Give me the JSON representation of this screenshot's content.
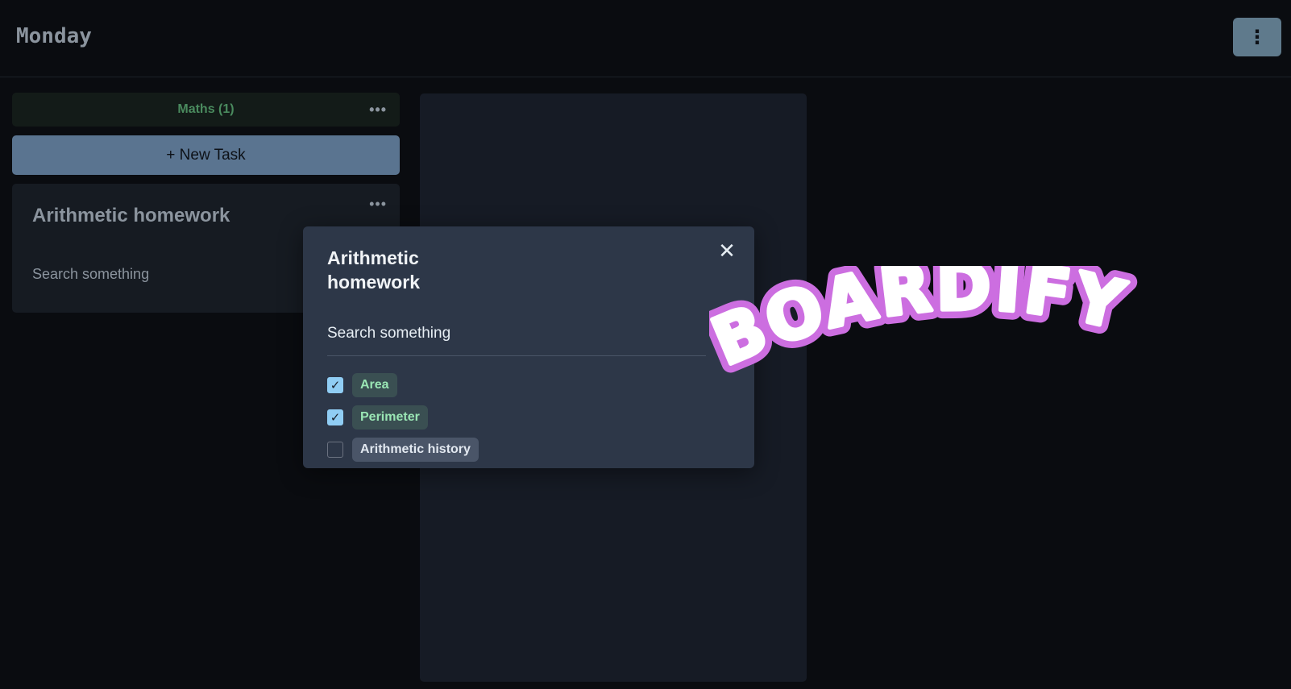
{
  "board": {
    "title": "Monday",
    "menu_icon": "kebab-vertical-icon"
  },
  "column": {
    "header": "Maths (1)",
    "new_task_label": "+ New Task",
    "cards": [
      {
        "title": "Arithmetic homework",
        "description": "Search something"
      }
    ]
  },
  "modal": {
    "title": "Arithmetic homework",
    "description": "Search something",
    "subtasks": [
      {
        "label": "Area",
        "checked": true
      },
      {
        "label": "Perimeter",
        "checked": true
      },
      {
        "label": "Arithmetic history",
        "checked": false
      }
    ]
  },
  "logo": {
    "text": "BOARDIFY"
  },
  "colors": {
    "background": "#0a0c10",
    "accent": "#5a7490",
    "logo_fill": "#ffffff",
    "logo_outline": "#cc6ee0"
  }
}
